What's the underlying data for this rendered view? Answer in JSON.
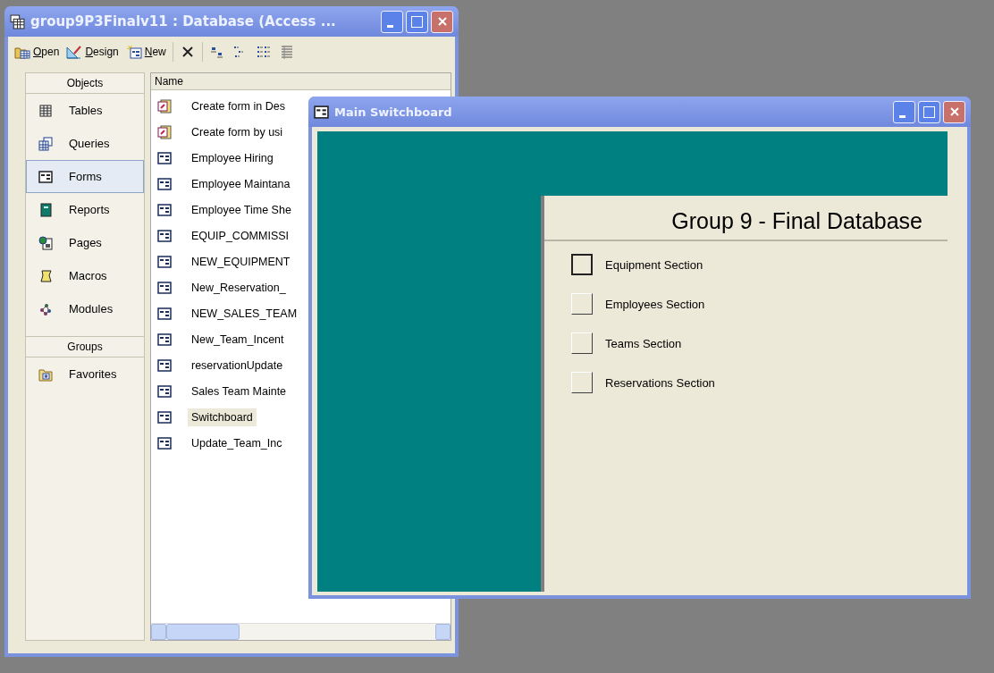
{
  "database_window": {
    "title": "group9P3Finalv11 : Database (Access ...",
    "toolbar": [
      {
        "kind": "open",
        "label": "Open"
      },
      {
        "kind": "design",
        "label": "Design"
      },
      {
        "kind": "new",
        "label": "New"
      },
      {
        "kind": "delete"
      },
      {
        "kind": "large-icons"
      },
      {
        "kind": "small-icons"
      },
      {
        "kind": "list"
      },
      {
        "kind": "details"
      }
    ],
    "objects_header": "Objects",
    "objects": [
      {
        "kind": "tables",
        "label": "Tables",
        "selected": false
      },
      {
        "kind": "queries",
        "label": "Queries",
        "selected": false
      },
      {
        "kind": "forms",
        "label": "Forms",
        "selected": true
      },
      {
        "kind": "reports",
        "label": "Reports",
        "selected": false
      },
      {
        "kind": "pages",
        "label": "Pages",
        "selected": false
      },
      {
        "kind": "macros",
        "label": "Macros",
        "selected": false
      },
      {
        "kind": "modules",
        "label": "Modules",
        "selected": false
      }
    ],
    "groups_header": "Groups",
    "groups": [
      {
        "label": "Favorites",
        "selected": false
      }
    ],
    "list_column": "Name",
    "items": [
      {
        "kind": "wizard",
        "name": "Create form in Des",
        "selected": false
      },
      {
        "kind": "wizard",
        "name": "Create form by usi",
        "selected": false
      },
      {
        "kind": "form",
        "name": "Employee Hiring",
        "selected": false
      },
      {
        "kind": "form",
        "name": "Employee Maintana",
        "selected": false
      },
      {
        "kind": "form",
        "name": "Employee Time She",
        "selected": false
      },
      {
        "kind": "form",
        "name": "EQUIP_COMMISSI",
        "selected": false
      },
      {
        "kind": "form",
        "name": "NEW_EQUIPMENT",
        "selected": false
      },
      {
        "kind": "form",
        "name": "New_Reservation_",
        "selected": false
      },
      {
        "kind": "form",
        "name": "NEW_SALES_TEAM",
        "selected": false
      },
      {
        "kind": "form",
        "name": "New_Team_Incent",
        "selected": false
      },
      {
        "kind": "form",
        "name": "reservationUpdate",
        "selected": false
      },
      {
        "kind": "form",
        "name": "Sales Team Mainte",
        "selected": false
      },
      {
        "kind": "form",
        "name": "Switchboard",
        "selected": true
      },
      {
        "kind": "form",
        "name": "Update_Team_Inc",
        "selected": false
      }
    ]
  },
  "switchboard_window": {
    "title": "Main Switchboard",
    "heading": "Group 9 - Final Database",
    "options": [
      {
        "label": "Equipment Section",
        "focused": true
      },
      {
        "label": "Employees Section",
        "focused": false
      },
      {
        "label": "Teams Section",
        "focused": false
      },
      {
        "label": "Reservations Section",
        "focused": false
      }
    ]
  }
}
